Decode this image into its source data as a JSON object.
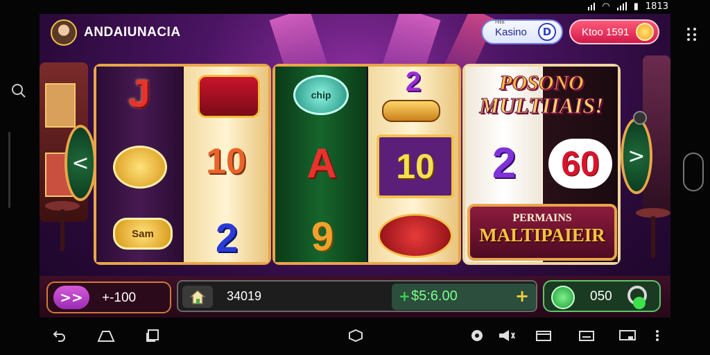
{
  "status_bar": {
    "time": "1813"
  },
  "header": {
    "player_name": "ANDAIUNACIA",
    "kasino_button": {
      "small_label": "Hilla",
      "label": "Kasino",
      "icon_letter": "D"
    },
    "coin_button": {
      "label": "Ktoo 1591"
    }
  },
  "reels": {
    "group1": {
      "col1": [
        "J",
        "coin",
        "Sam"
      ],
      "col2": [
        "crown",
        "10",
        "2"
      ]
    },
    "group2": {
      "col1": [
        "chip",
        "A",
        "9"
      ],
      "col2": [
        "2",
        "10",
        "pot"
      ]
    },
    "group3": {
      "col1": [
        "2"
      ],
      "col2": [
        "60"
      ]
    }
  },
  "promo": {
    "title_line1": "POSONO",
    "title_line2": "MULTIIAIS!",
    "box_line1": "PERMAINS",
    "box_line2": "MALTIPAIEIR"
  },
  "bottom_bar": {
    "bet_icon": ">>",
    "bet_value": "+-100",
    "credits": "34019",
    "win_plus_left": "+",
    "win_amount": "$5:6.00",
    "win_plus_right": "+",
    "coins": "050"
  },
  "nav": {
    "left_arrow": "<",
    "right_arrow": ">"
  },
  "colors": {
    "frame": "#e8a64a",
    "background": "#4a1462",
    "win_green": "#7dff8e",
    "bet_purple": "#9b2bb5"
  }
}
